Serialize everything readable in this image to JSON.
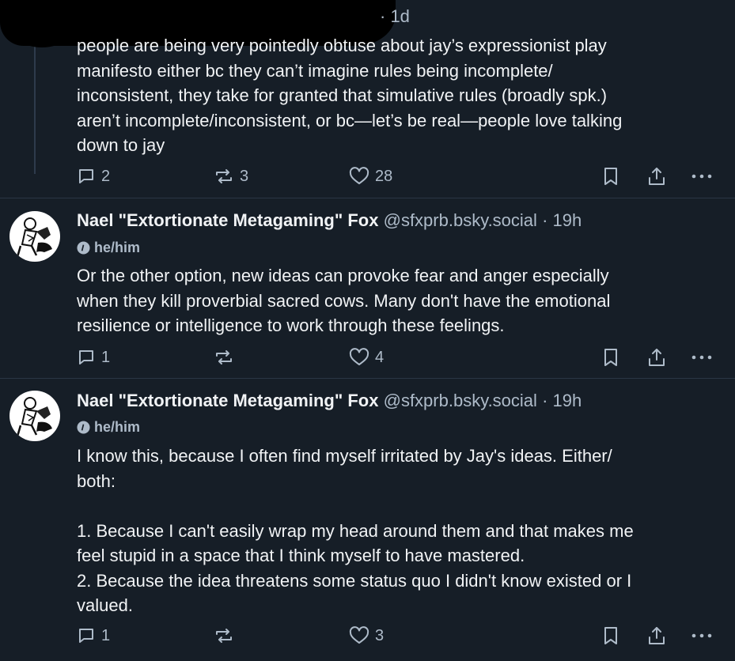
{
  "colors": {
    "background": "#161e27",
    "text": "#f1f3f5",
    "muted": "#aebbc9"
  },
  "posts": [
    {
      "timestamp": "· 1d",
      "text": "people are being very pointedly obtuse about jay’s expressionist play\nmanifesto either bc they can’t imagine rules being incomplete/\ninconsistent, they take for granted that simulative rules (broadly spk.)\naren’t incomplete/inconsistent, or bc—let’s be real—people love talking\ndown to jay",
      "replies": "2",
      "reposts": "3",
      "likes": "28"
    },
    {
      "display_name": "Nael \"Extortionate Metagaming\" Fox",
      "handle": "@sfxprb.bsky.social",
      "timestamp": "· 19h",
      "pronouns": "he/him",
      "text": "Or the other option, new ideas can provoke fear and anger especially\nwhen they kill proverbial sacred cows. Many don't have the emotional\nresilience or intelligence to work through these feelings.",
      "replies": "1",
      "reposts": "",
      "likes": "4"
    },
    {
      "display_name": "Nael \"Extortionate Metagaming\" Fox",
      "handle": "@sfxprb.bsky.social",
      "timestamp": "· 19h",
      "pronouns": "he/him",
      "text": "I know this, because I often find myself irritated by Jay's ideas. Either/\nboth:\n\n1. Because I can't easily wrap my head around them and that makes me\nfeel stupid in a space that I think myself to have mastered.\n2. Because the idea threatens some status quo I didn't know existed or I\nvalued.",
      "replies": "1",
      "reposts": "",
      "likes": "3"
    }
  ],
  "icons": {
    "reply": "reply-bubble-icon",
    "repost": "repost-arrows-icon",
    "like": "heart-icon",
    "bookmark": "bookmark-icon",
    "share": "share-icon",
    "more": "more-dots-icon",
    "pronoun": "info-circle-icon"
  }
}
